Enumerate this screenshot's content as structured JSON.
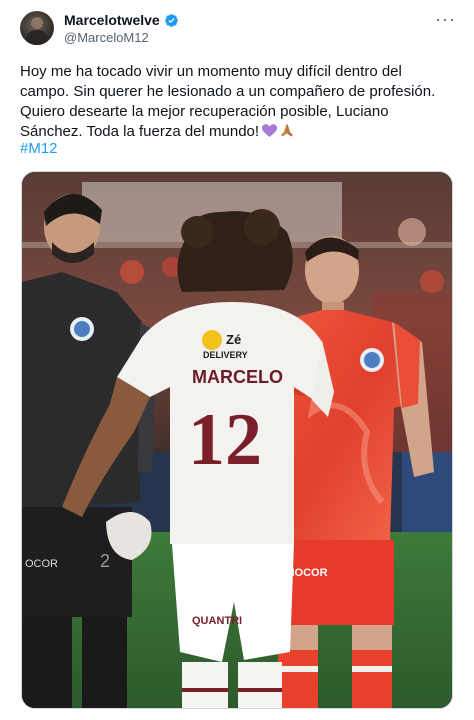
{
  "tweet": {
    "display_name": "Marcelotwelve",
    "handle": "@MarceloM12",
    "text_lines": [
      "Hoy me ha tocado vivir un momento muy difícil dentro del",
      "campo. Sin querer he lesionado a un compañero de profesión.",
      "Quiero desearte la mejor recuperación posible, Luciano",
      "Sánchez. Toda la fuerza del mundo!"
    ],
    "hashtag": "#M12",
    "more_label": "···"
  },
  "photo": {
    "jersey_name": "MARCELO",
    "jersey_number": "12",
    "sponsor": "DELIVERY",
    "shorts_sponsor": "QUANTRI",
    "right_sponsor": "NGIOCOR",
    "left_sponsor": "OCOR"
  },
  "colors": {
    "accent": "#1d9bf0",
    "verified": "#1d9bf0",
    "text_secondary": "#536471",
    "red_kit": "#e8412c",
    "white_kit": "#f4f2ef",
    "maroon_number": "#7a1e2a"
  }
}
